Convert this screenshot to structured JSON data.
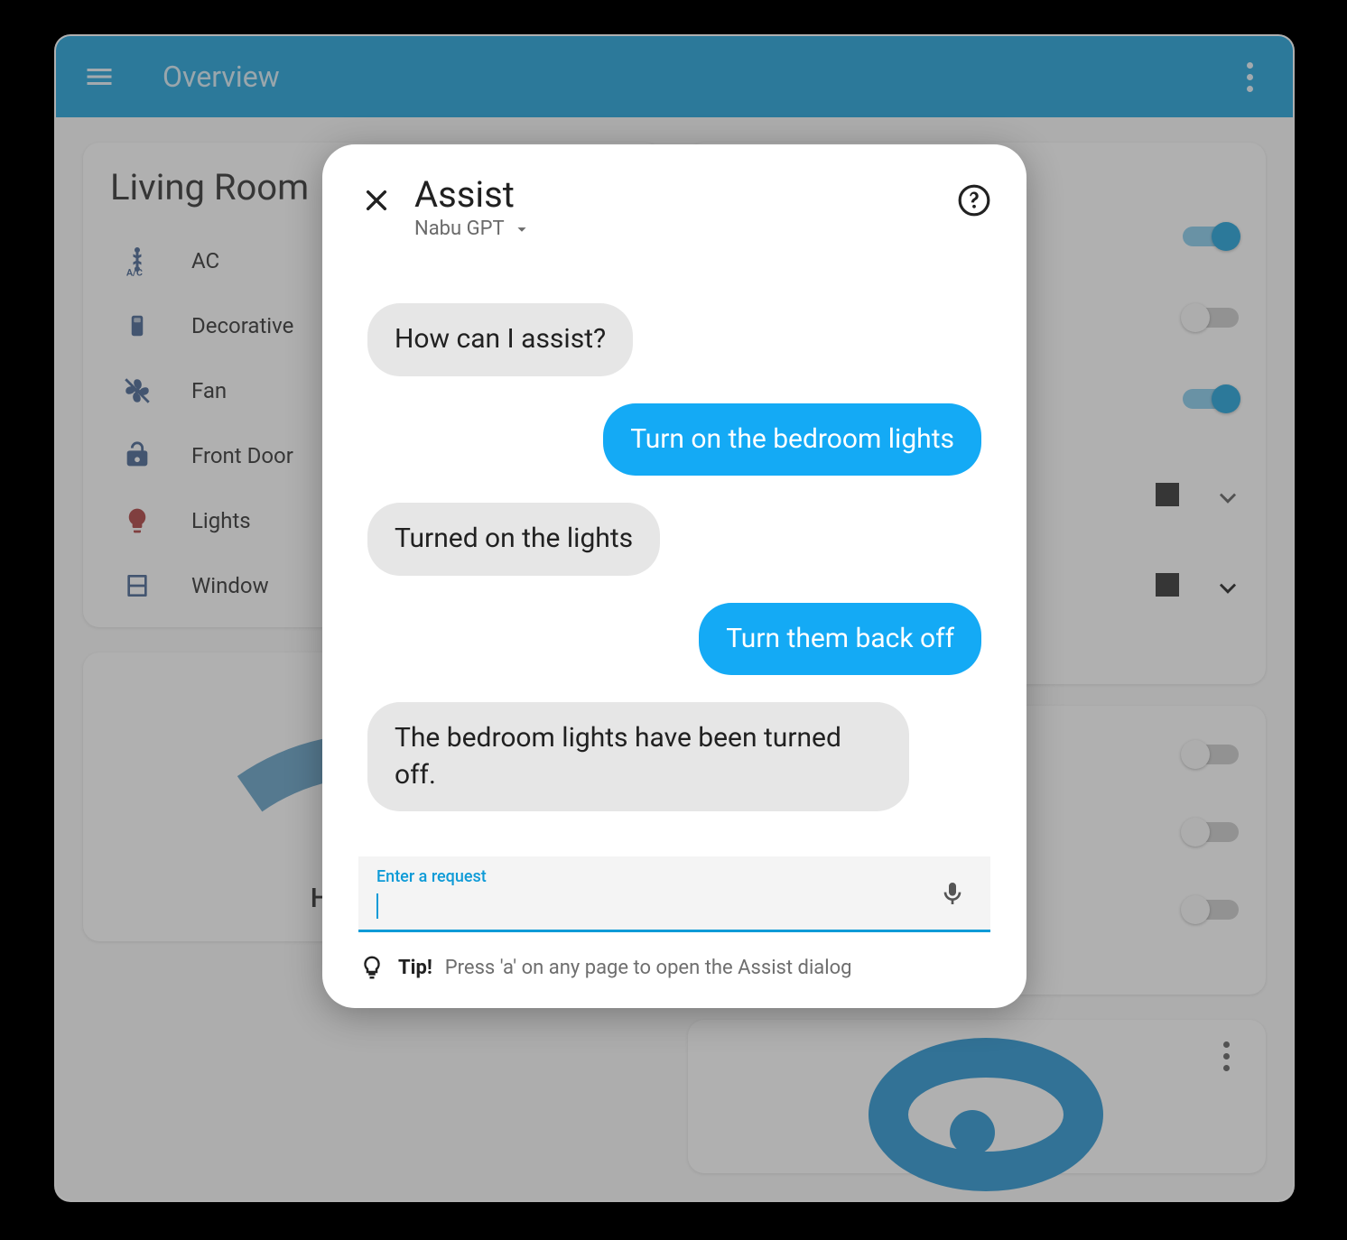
{
  "appbar": {
    "title": "Overview"
  },
  "living_room": {
    "title": "Living Room",
    "rows": {
      "ac": {
        "label": "AC"
      },
      "decorative": {
        "label": "Decorative"
      },
      "fan": {
        "label": "Fan"
      },
      "front_door": {
        "label": "Front Door"
      },
      "lights": {
        "label": "Lights"
      },
      "window": {
        "label": "Window"
      }
    }
  },
  "thermostat": {
    "title": "Heat/Cool"
  },
  "dialog": {
    "title": "Assist",
    "subtitle": "Nabu GPT",
    "input_label": "Enter a request",
    "input_value": "",
    "tip_bold": "Tip!",
    "tip_text": "Press 'a' on any page to open the Assist dialog",
    "messages": [
      {
        "role": "bot",
        "text": "How can I assist?"
      },
      {
        "role": "user",
        "text": "Turn on the bedroom lights"
      },
      {
        "role": "bot",
        "text": "Turned on the lights"
      },
      {
        "role": "user",
        "text": "Turn them back off"
      },
      {
        "role": "bot",
        "text": "The bedroom lights have been turned off."
      }
    ]
  }
}
